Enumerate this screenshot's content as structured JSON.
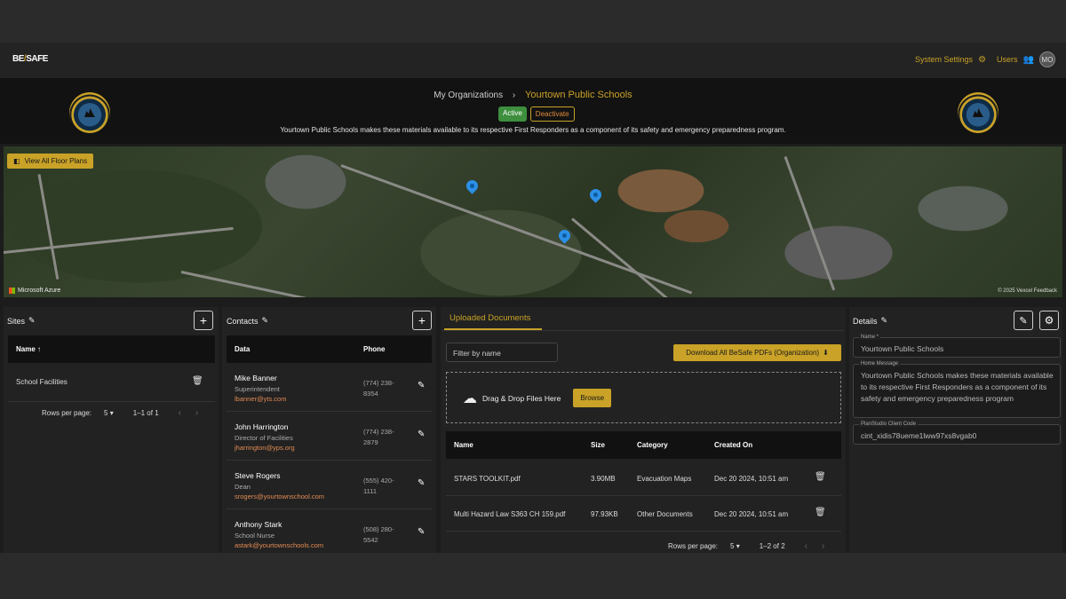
{
  "topbar": {
    "logo_be": "BE",
    "logo_slash": "/",
    "logo_safe": "SAFE",
    "system_settings": "System Settings",
    "users": "Users",
    "avatar_initials": "MO"
  },
  "org": {
    "breadcrumb_parent": "My Organizations",
    "breadcrumb_sep": "›",
    "breadcrumb_current": "Yourtown Public Schools",
    "status": "Active",
    "deactivate_label": "Deactivate",
    "message": "Yourtown Public Schools makes these materials available to its respective First Responders as a component of its safety and emergency preparedness program."
  },
  "map": {
    "view_floor_plans": "View All Floor Plans",
    "provider": "Microsoft Azure",
    "attribution": "© 2025 Vexcel  Feedback"
  },
  "sites": {
    "title": "Sites",
    "column_name": "Name",
    "rows": [
      {
        "name": "School Facilities"
      }
    ],
    "rows_per_page_label": "Rows per page:",
    "rows_per_page": "5",
    "range": "1–1 of 1"
  },
  "contacts": {
    "title": "Contacts",
    "column_data": "Data",
    "column_phone": "Phone",
    "rows": [
      {
        "name": "Mike Banner",
        "role": "Superintendent",
        "email": "lbanner@yts.com",
        "phone": "(774) 238-8354"
      },
      {
        "name": "John Harrington",
        "role": "Director of Facilities",
        "email": "jharrington@yps.org",
        "phone": "(774) 238-2879"
      },
      {
        "name": "Steve Rogers",
        "role": "Dean",
        "email": "srogers@yourtownschool.com",
        "phone": "(555) 420-1111"
      },
      {
        "name": "Anthony Stark",
        "role": "School Nurse",
        "email": "astark@yourtownschools.com",
        "phone": "(508) 280-5542"
      }
    ]
  },
  "documents": {
    "tab_label": "Uploaded Documents",
    "filter_placeholder": "Filter by name",
    "download_all": "Download All BeSafe PDFs (Organization)",
    "drop_text": "Drag & Drop Files Here",
    "browse_label": "Browse",
    "columns": {
      "name": "Name",
      "size": "Size",
      "category": "Category",
      "created": "Created On"
    },
    "rows": [
      {
        "name": "STARS TOOLKIT.pdf",
        "size": "3.90MB",
        "category": "Evacuation Maps",
        "created": "Dec 20 2024, 10:51 am"
      },
      {
        "name": "Multi Hazard Law S363 CH 159.pdf",
        "size": "97.93KB",
        "category": "Other Documents",
        "created": "Dec 20 2024, 10:51 am"
      }
    ],
    "rows_per_page_label": "Rows per page:",
    "rows_per_page": "5",
    "range": "1–2 of 2"
  },
  "details": {
    "title": "Details",
    "name_label": "Name *",
    "name_value": "Yourtown Public Schools",
    "home_message_label": "Home Message",
    "home_message_value": "Yourtown Public Schools makes these materials available to its respective First Responders as a component of its safety and emergency preparedness program",
    "client_code_label": "PlanStudio Client Code",
    "client_code_value": "cint_xidis78ueme1lww97xs8vgab0"
  },
  "colors": {
    "accent": "#c9a227",
    "active": "#3d8f3d",
    "email": "#e38b54",
    "pin": "#2b8fe6"
  }
}
